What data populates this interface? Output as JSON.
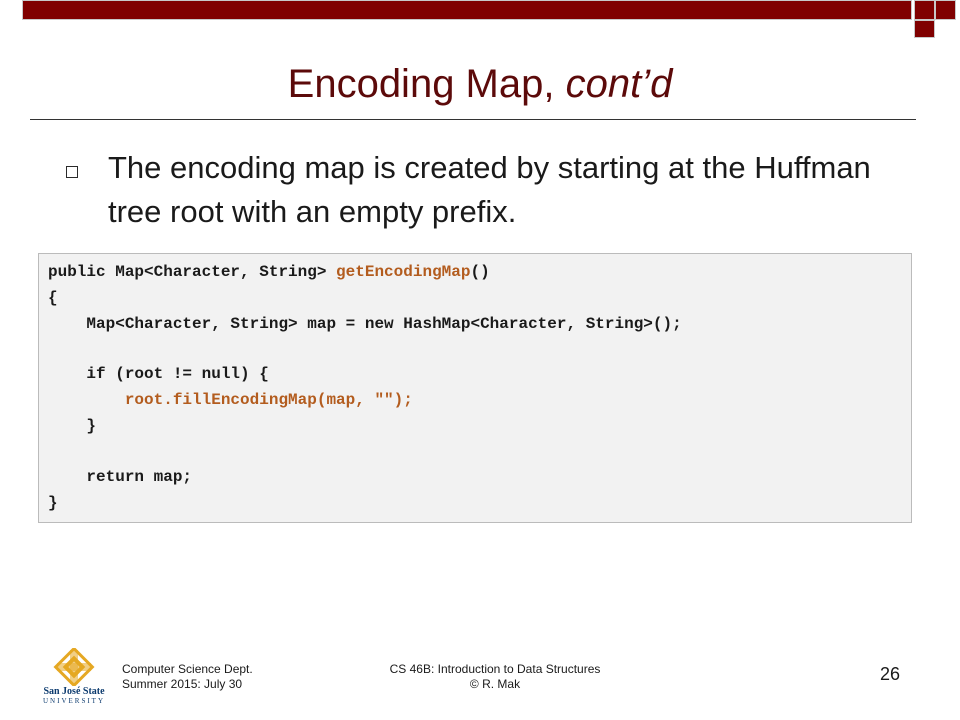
{
  "slide": {
    "title_main": "Encoding Map, ",
    "title_italic": "cont’d",
    "bullet_text": "The encoding map is created by starting at the Huffman tree root with an empty prefix."
  },
  "code": {
    "l1a": "public Map<Character, String> ",
    "l1b": "getEncodingMap",
    "l1c": "()",
    "l2": "{",
    "l3": "    Map<Character, String> map = new HashMap<Character, String>();",
    "l4": "    if (root != null) {",
    "l5": "        root.fillEncodingMap(map, \"\");",
    "l6": "    }",
    "l7": "    return map;",
    "l8": "}"
  },
  "footer": {
    "dept": "Computer Science Dept.",
    "term": "Summer 2015: July 30",
    "course": "CS 46B: Introduction to Data Structures",
    "author": "© R. Mak",
    "page_number": "26"
  },
  "logo": {
    "name_line1": "San José State",
    "name_line2": "UNIVERSITY",
    "color_gold": "#e5a823",
    "color_blue": "#0b3a6e"
  },
  "colors": {
    "accent": "#800000",
    "title": "#5c0a0a",
    "code_highlight": "#b35c1e",
    "code_bg": "#f2f2f2"
  }
}
